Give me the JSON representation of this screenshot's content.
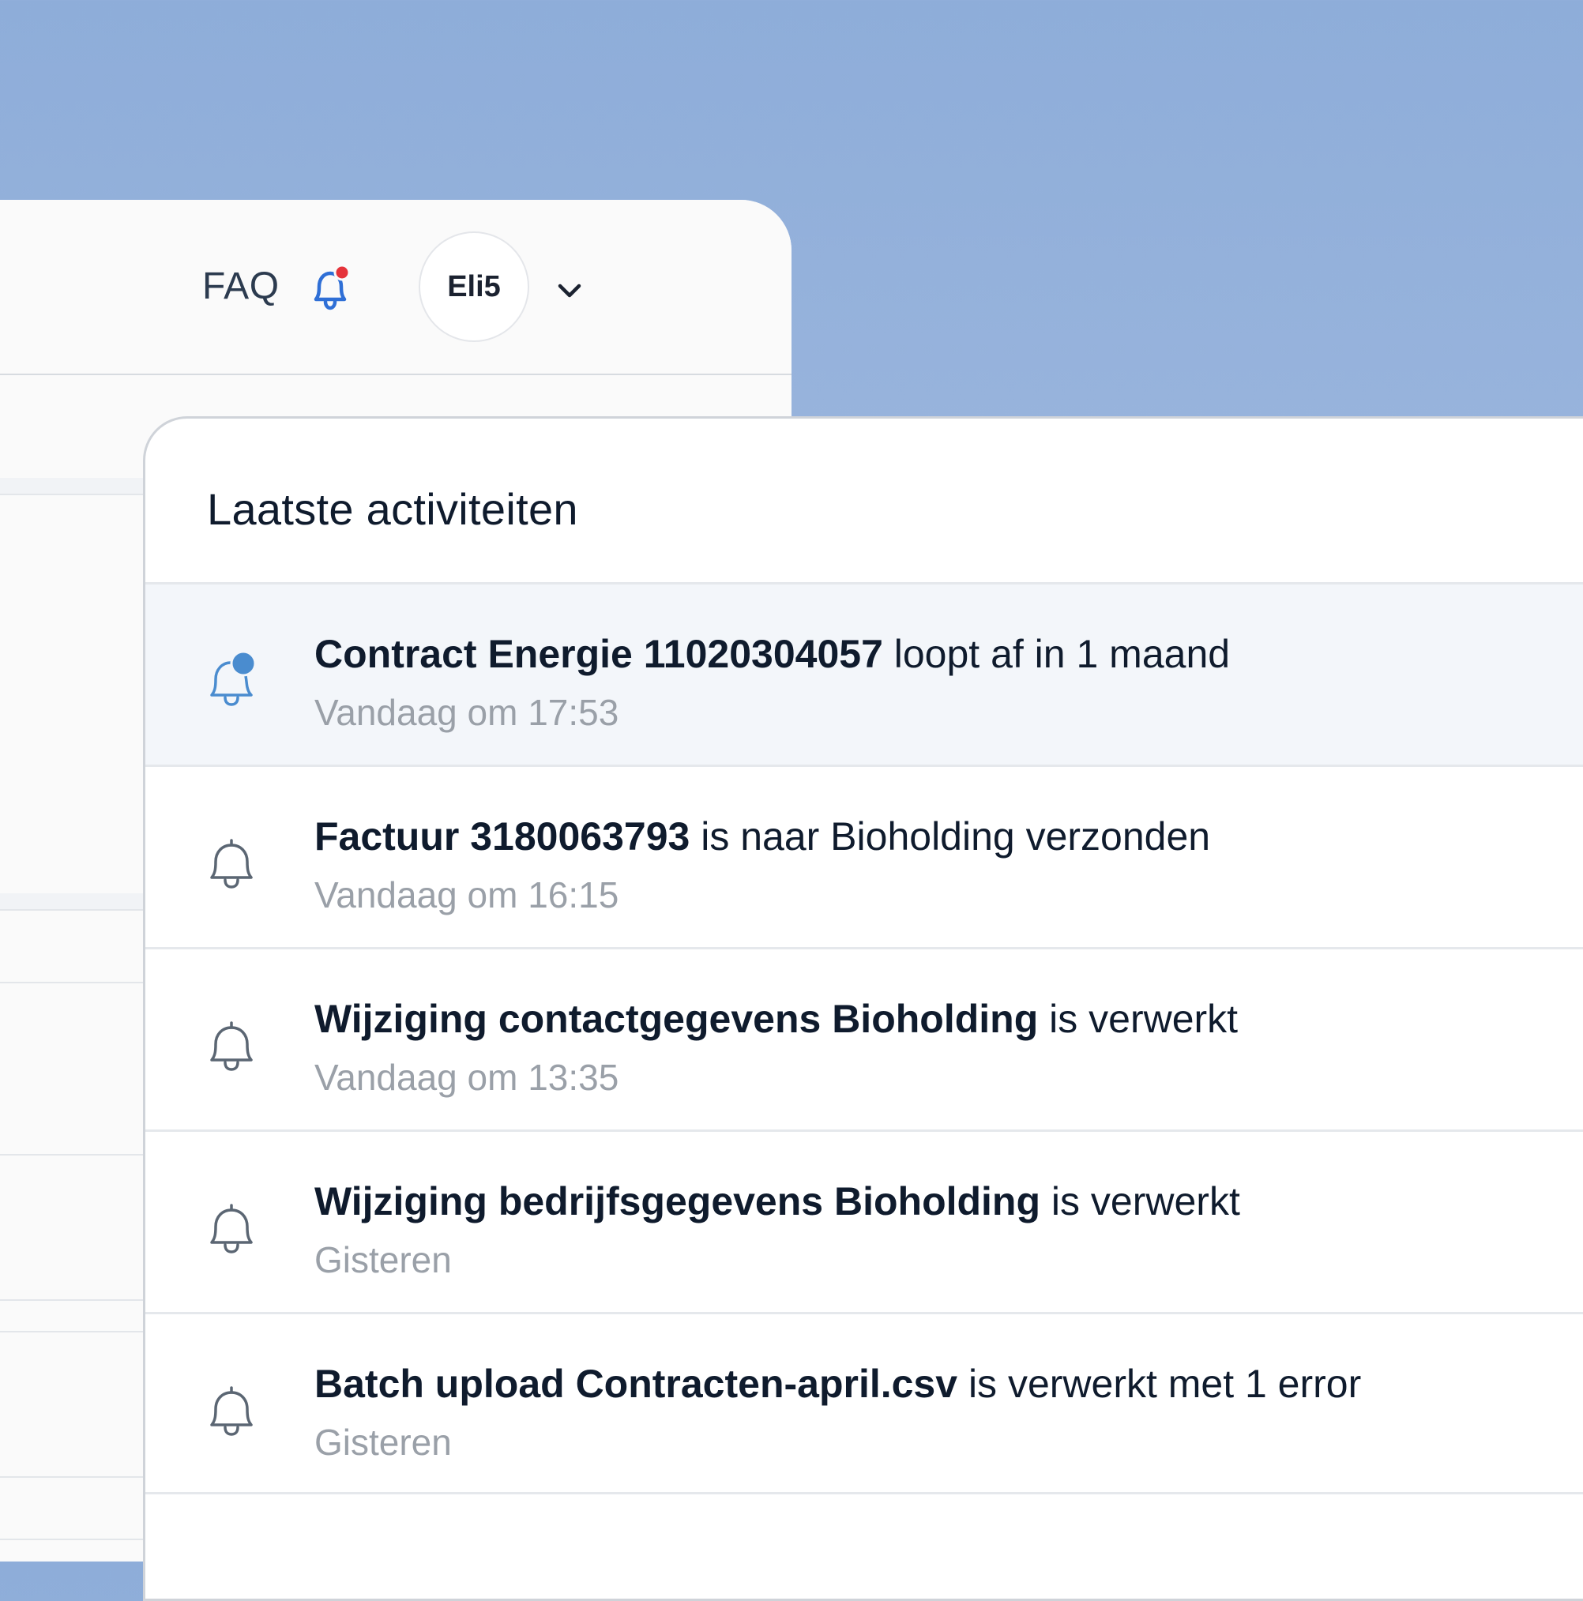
{
  "header": {
    "faq_label": "FAQ",
    "user_initials": "Eli5",
    "bell_has_unread": true
  },
  "notifications": {
    "title": "Laatste activiteiten",
    "items": [
      {
        "subject": "Contract Energie 11020304057",
        "message": " loopt af in 1 maand",
        "time": "Vandaag om 17:53",
        "unread": true
      },
      {
        "subject": "Factuur 3180063793",
        "message": " is naar Bioholding verzonden",
        "time": "Vandaag om 16:15",
        "unread": false
      },
      {
        "subject": "Wijziging contactgegevens Bioholding",
        "message": " is verwerkt",
        "time": "Vandaag om 13:35",
        "unread": false
      },
      {
        "subject": "Wijziging bedrijfsgegevens Bioholding",
        "message": " is verwerkt",
        "time": "Gisteren",
        "unread": false
      },
      {
        "subject": "Batch upload Contracten-april.csv",
        "message": " is verwerkt met 1 error",
        "time": "Gisteren",
        "unread": false
      }
    ]
  },
  "colors": {
    "accent": "#2f6fd6",
    "unread_dot": "#e5333a",
    "unread_badge": "#4a8ccf",
    "bell_default": "#5b6673"
  }
}
